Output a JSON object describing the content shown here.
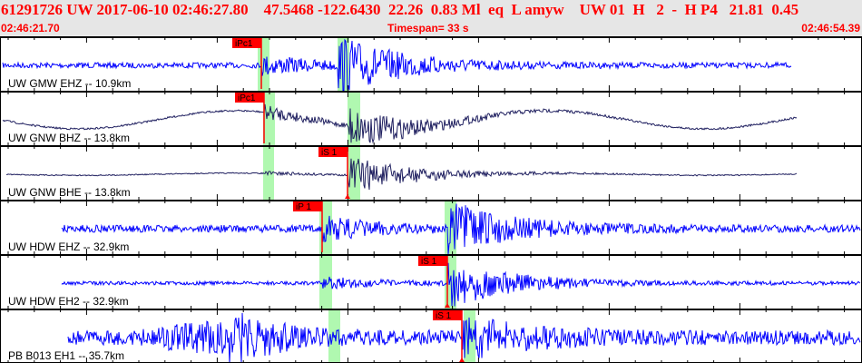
{
  "header": {
    "title": "61291726 UW 2017-06-10 02:46:27.80    47.5468 -122.6430  22.26  0.83 Ml  eq  L amyw    UW 01  H   2  -  H P4   21.81  0.45",
    "start_time": "02:46:21.70",
    "timespan": "Timespan=  33 s",
    "end_time": "02:46:54.39"
  },
  "colors": {
    "header_text": "#ff0000",
    "pick": "#ff0000",
    "window": "#b0f8b0",
    "trace_short_period": "#0000ff",
    "trace_broadband": "#202060"
  },
  "channels": [
    {
      "label": "UW GMW EHZ -- 10.9km",
      "pick": "iPc1",
      "trace_color": "#0000ff"
    },
    {
      "label": "UW GNW BHZ -- 13.8km",
      "pick": "iPc1",
      "trace_color": "#202060"
    },
    {
      "label": "UW GNW BHE -- 13.8km",
      "pick": "iS 1",
      "trace_color": "#202060"
    },
    {
      "label": "UW HDW EHZ -- 32.9km",
      "pick": "iP 1",
      "trace_color": "#0000ff"
    },
    {
      "label": "UW HDW EH2 -- 32.9km",
      "pick": "iS 1",
      "trace_color": "#0000ff"
    },
    {
      "label": "PB B013 EH1 -- 35.7km",
      "pick": "iS 1",
      "trace_color": "#0000ff"
    }
  ]
}
